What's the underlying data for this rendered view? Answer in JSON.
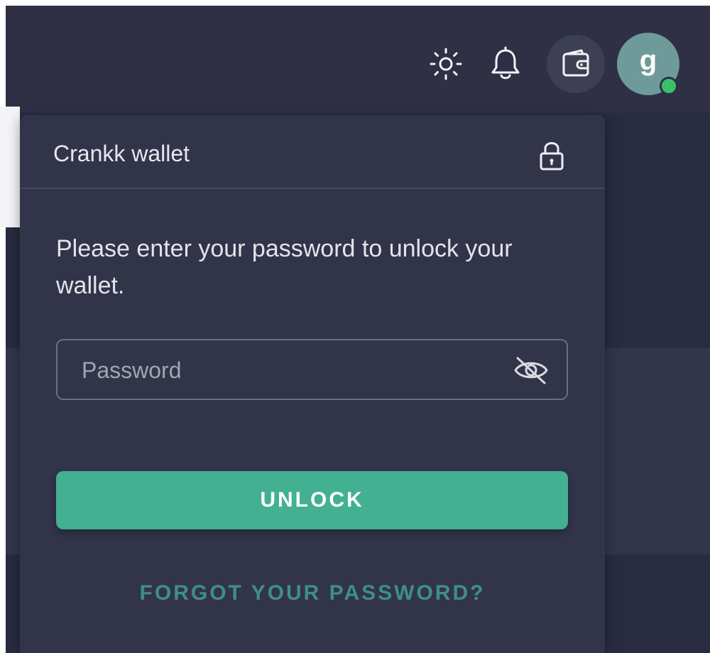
{
  "topbar": {
    "icons": {
      "theme": "sun-icon",
      "notifications": "bell-icon",
      "wallet": "wallet-icon"
    },
    "avatar": {
      "initial": "g",
      "status": "online",
      "color": "#6f9a9a",
      "status_color": "#37c26a"
    }
  },
  "wallet_panel": {
    "title": "Crankk wallet",
    "lock_icon": "lock-icon",
    "message": "Please enter your password to unlock your wallet.",
    "password_field": {
      "placeholder": "Password",
      "value": "",
      "toggle_icon": "eye-slash-icon"
    },
    "unlock_label": "UNLOCK",
    "forgot_label": "FORGOT YOUR PASSWORD?"
  },
  "colors": {
    "accent": "#43b091",
    "panel_bg": "#32344a",
    "link": "#3f8f86"
  }
}
